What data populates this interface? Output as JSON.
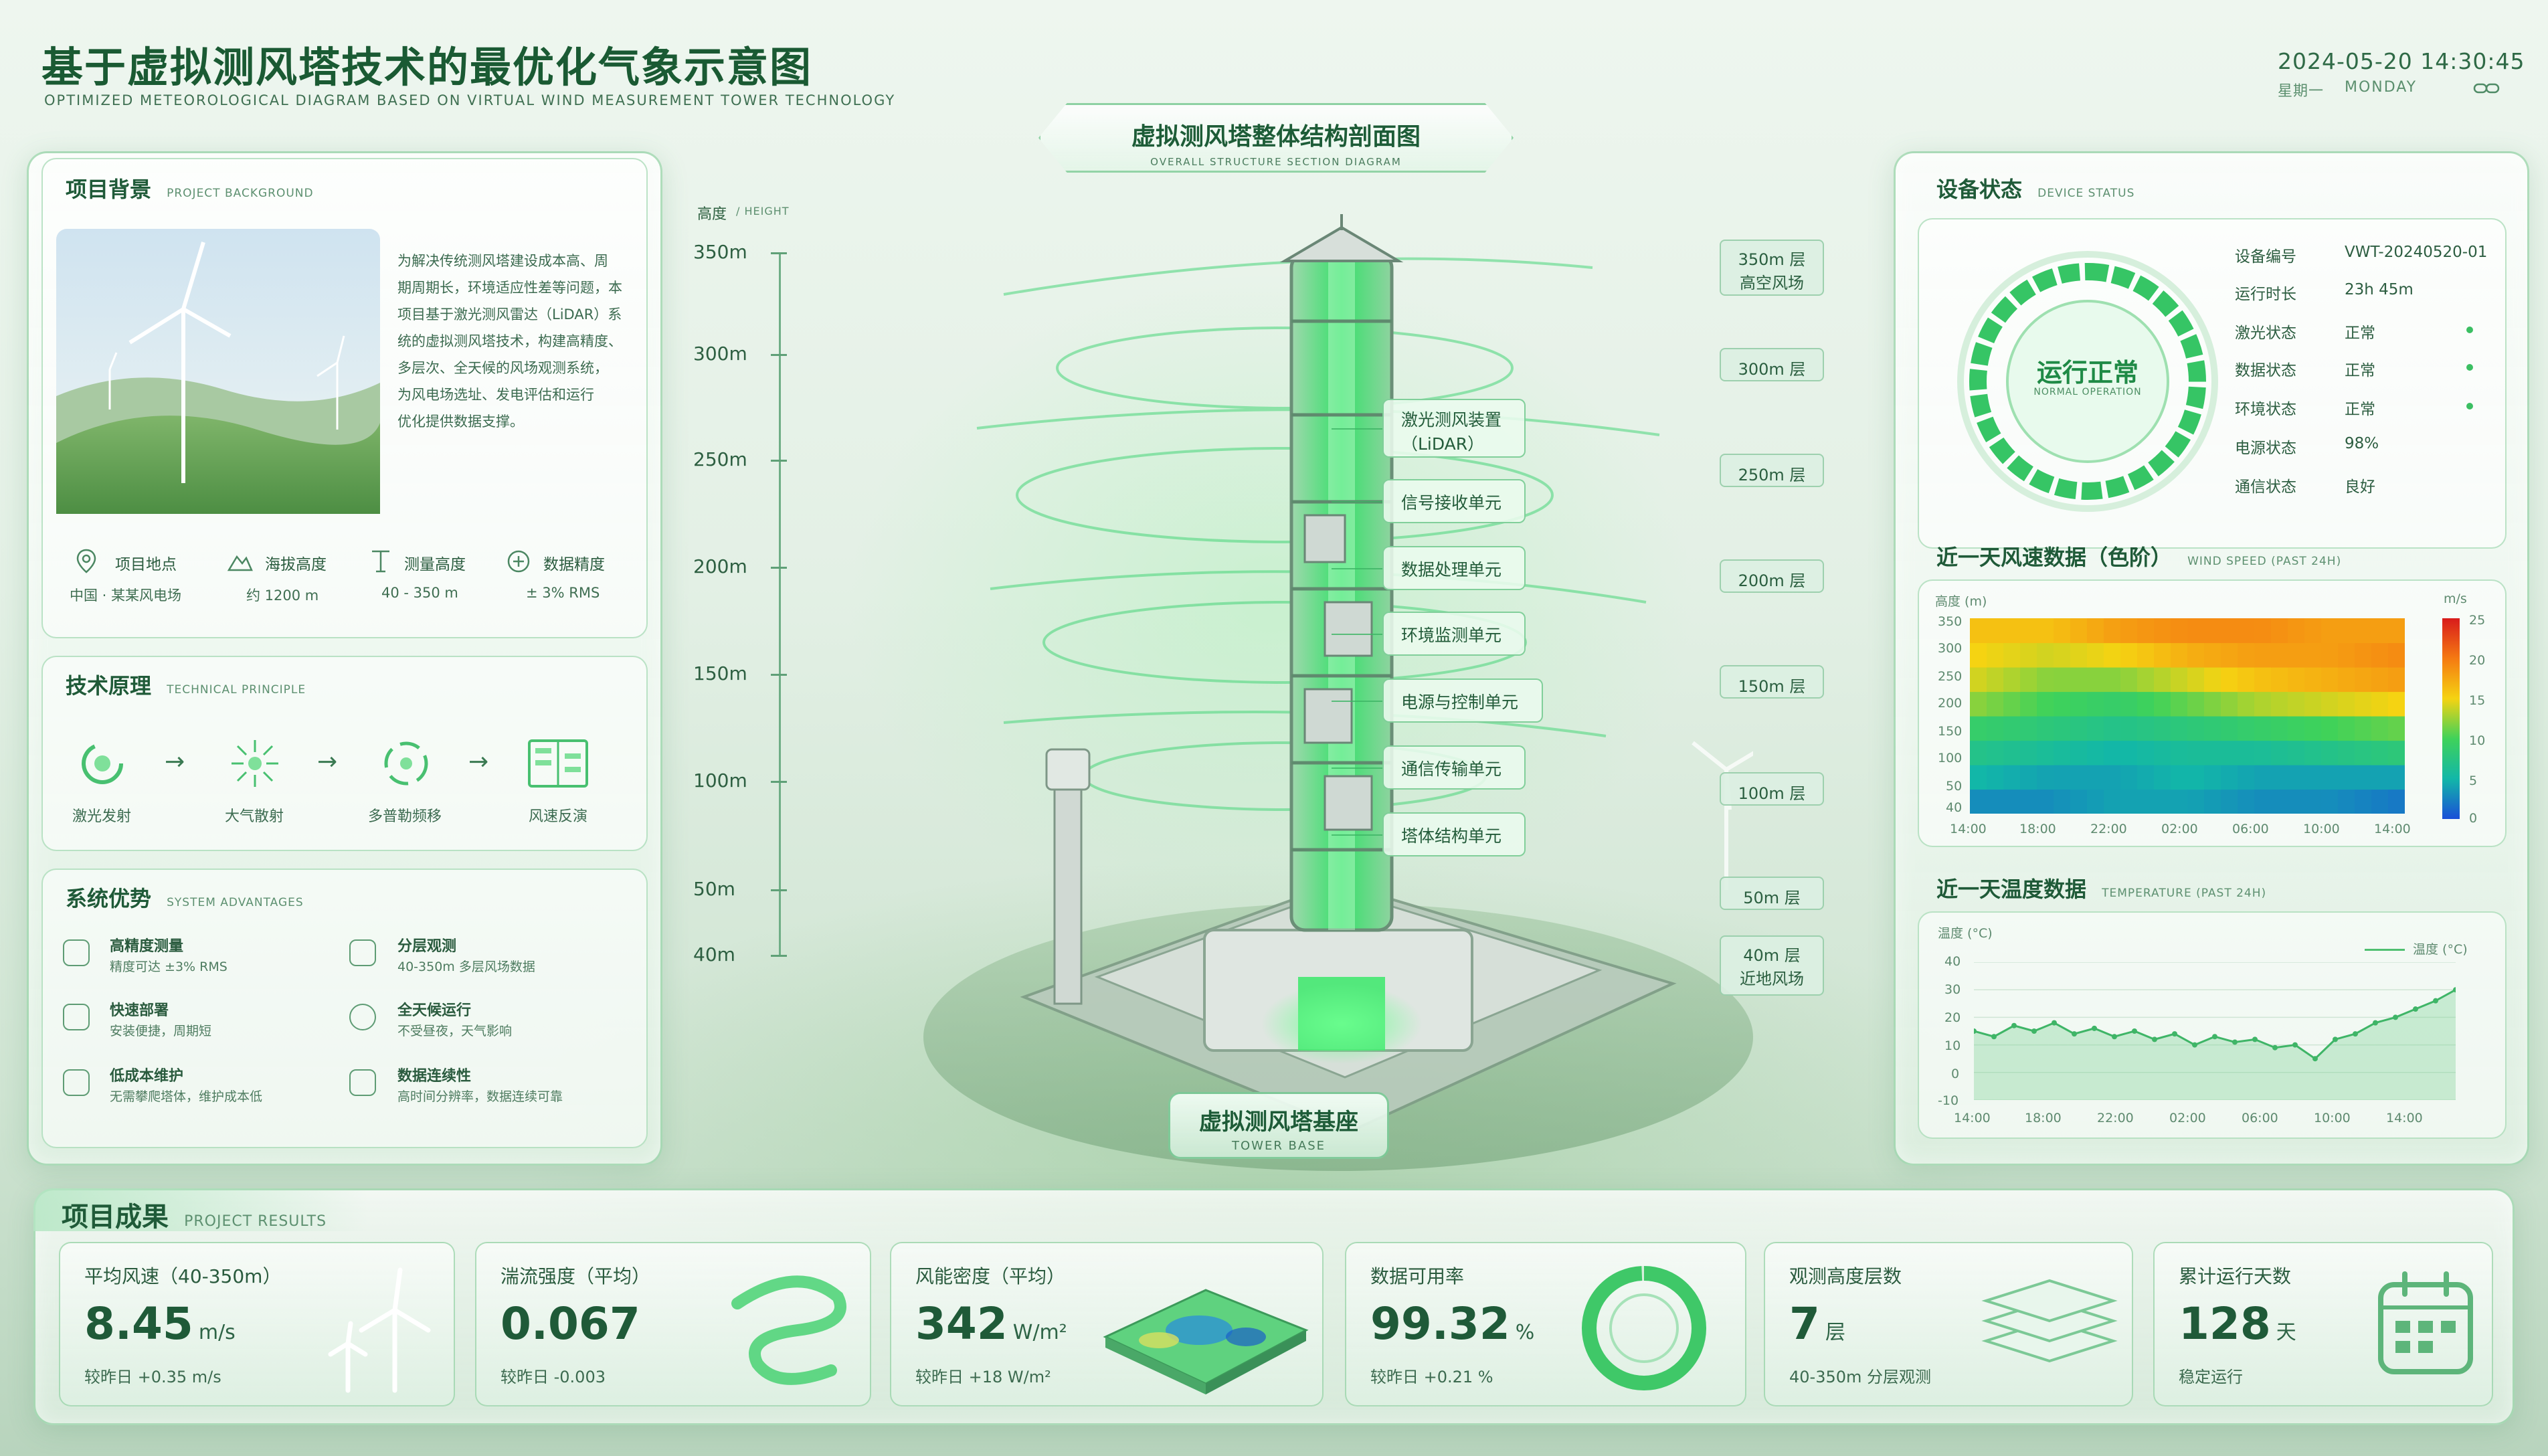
{
  "header": {
    "title": "基于虚拟测风塔技术的最优化气象示意图",
    "subtitle": "OPTIMIZED METEOROLOGICAL DIAGRAM BASED ON VIRTUAL WIND MEASUREMENT TOWER TECHNOLOGY",
    "datetime": "2024-05-20  14:30:45",
    "weekday": "星期一",
    "weekday_en": "MONDAY"
  },
  "center": {
    "title": "虚拟测风塔整体结构剖面图",
    "subtitle": "OVERALL STRUCTURE SECTION DIAGRAM",
    "height_label": "高度",
    "height_label_en": "/ HEIGHT",
    "axis_ticks": [
      "350m",
      "300m",
      "250m",
      "200m",
      "150m",
      "100m",
      "50m",
      "40m"
    ],
    "components": [
      {
        "line1": "激光测风装置",
        "line2": "（LiDAR）"
      },
      {
        "line1": "信号接收单元"
      },
      {
        "line1": "数据处理单元"
      },
      {
        "line1": "环境监测单元"
      },
      {
        "line1": "电源与控制单元"
      },
      {
        "line1": "通信传输单元"
      },
      {
        "line1": "塔体结构单元"
      }
    ],
    "layers": [
      {
        "line1": "350m 层",
        "line2": "高空风场"
      },
      {
        "line1": "300m 层"
      },
      {
        "line1": "250m 层"
      },
      {
        "line1": "200m 层"
      },
      {
        "line1": "150m 层"
      },
      {
        "line1": "100m 层"
      },
      {
        "line1": "50m 层"
      },
      {
        "line1": "40m 层",
        "line2": "近地风场"
      }
    ],
    "base_title": "虚拟测风塔基座",
    "base_subtitle": "TOWER BASE"
  },
  "background": {
    "title": "项目背景",
    "title_en": "PROJECT BACKGROUND",
    "text_lines": [
      "为解决传统测风塔建设成本高、周",
      "期周期长，环境适应性差等问题，本",
      "项目基于激光测风雷达（LiDAR）系",
      "统的虚拟测风塔技术，构建高精度、",
      "多层次、全天候的风场观测系统，",
      "为风电场选址、发电评估和运行",
      "优化提供数据支撑。"
    ],
    "stats": [
      {
        "label": "项目地点",
        "value": "中国 · 某某风电场",
        "icon": "location-pin-icon"
      },
      {
        "label": "海拔高度",
        "value": "约 1200 m",
        "icon": "mountain-icon"
      },
      {
        "label": "测量高度",
        "value": "40 - 350 m",
        "icon": "height-ruler-icon"
      },
      {
        "label": "数据精度",
        "value": "± 3% RMS",
        "icon": "target-icon"
      }
    ]
  },
  "principle": {
    "title": "技术原理",
    "title_en": "TECHNICAL PRINCIPLE",
    "steps": [
      {
        "label": "激光发射",
        "icon": "laser-emit-icon"
      },
      {
        "label": "大气散射",
        "icon": "scatter-icon"
      },
      {
        "label": "多普勒频移",
        "icon": "doppler-icon"
      },
      {
        "label": "风速反演",
        "icon": "inversion-chart-icon"
      }
    ]
  },
  "advantages": {
    "title": "系统优势",
    "title_en": "SYSTEM ADVANTAGES",
    "items": [
      {
        "title": "高精度测量",
        "desc": "精度可达 ±3% RMS",
        "icon": "precision-icon"
      },
      {
        "title": "分层观测",
        "desc": "40-350m 多层风场数据",
        "icon": "layers-icon"
      },
      {
        "title": "快速部署",
        "desc": "安装便捷，周期短",
        "icon": "deploy-icon"
      },
      {
        "title": "全天候运行",
        "desc": "不受昼夜，天气影响",
        "icon": "clock-icon"
      },
      {
        "title": "低成本维护",
        "desc": "无需攀爬塔体，维护成本低",
        "icon": "maintenance-icon"
      },
      {
        "title": "数据连续性",
        "desc": "高时间分辨率，数据连续可靠",
        "icon": "data-continuity-icon"
      }
    ]
  },
  "device": {
    "title": "设备状态",
    "title_en": "DEVICE STATUS",
    "ring_text": "运行正常",
    "ring_text_en": "NORMAL OPERATION",
    "rows": [
      {
        "label": "设备编号",
        "value": "VWT-20240520-01",
        "dot": false
      },
      {
        "label": "运行时长",
        "value": "23h 45m",
        "dot": false
      },
      {
        "label": "激光状态",
        "value": "正常",
        "dot": true
      },
      {
        "label": "数据状态",
        "value": "正常",
        "dot": true
      },
      {
        "label": "环境状态",
        "value": "正常",
        "dot": true
      },
      {
        "label": "电源状态",
        "value": "98%",
        "dot": false
      },
      {
        "label": "通信状态",
        "value": "良好",
        "dot": false
      }
    ]
  },
  "wind_panel": {
    "title": "近一天风速数据（色阶）",
    "title_en": "WIND SPEED (PAST 24H)",
    "ylabel": "高度 (m)",
    "unit": "m/s",
    "y_ticks": [
      "350",
      "300",
      "250",
      "200",
      "150",
      "100",
      "50",
      "40"
    ],
    "x_ticks": [
      "14:00",
      "18:00",
      "22:00",
      "02:00",
      "06:00",
      "10:00",
      "14:00"
    ],
    "scale_ticks": [
      "25",
      "20",
      "15",
      "10",
      "5",
      "0"
    ]
  },
  "temp_panel": {
    "title": "近一天温度数据",
    "title_en": "TEMPERATURE (PAST 24H)",
    "ylabel": "温度 (°C)",
    "legend": "温度 (°C)",
    "y_ticks": [
      "40",
      "30",
      "20",
      "10",
      "0",
      "-10"
    ],
    "x_ticks": [
      "14:00",
      "18:00",
      "22:00",
      "02:00",
      "06:00",
      "10:00",
      "14:00"
    ]
  },
  "results": {
    "title": "项目成果",
    "title_en": "PROJECT RESULTS",
    "cards": [
      {
        "title": "平均风速（40-350m）",
        "value": "8.45",
        "unit": "m/s",
        "note": "较昨日 +0.35 m/s",
        "icon": "wind-turbine-icon"
      },
      {
        "title": "湍流强度（平均）",
        "value": "0.067",
        "unit": "",
        "note": "较昨日 -0.003",
        "icon": "turbulence-swirl-icon"
      },
      {
        "title": "风能密度（平均）",
        "value": "342",
        "unit": "W/m²",
        "note": "较昨日 +18 W/m²",
        "icon": "terrain-map-icon"
      },
      {
        "title": "数据可用率",
        "value": "99.32",
        "unit": "%",
        "note": "较昨日 +0.21 %",
        "icon": "ring-gauge-icon",
        "fraction": 0.9932
      },
      {
        "title": "观测高度层数",
        "value": "7",
        "unit": "层",
        "note": "40-350m 分层观测",
        "icon": "stacked-layers-icon"
      },
      {
        "title": "累计运行天数",
        "value": "128",
        "unit": "天",
        "note": "稳定运行",
        "icon": "calendar-icon"
      }
    ]
  },
  "chart_data": [
    {
      "type": "heatmap",
      "title": "近一天风速数据（色阶）",
      "xlabel": "",
      "ylabel": "高度 (m)",
      "x": [
        "14:00",
        "18:00",
        "22:00",
        "02:00",
        "06:00",
        "10:00",
        "14:00"
      ],
      "y": [
        40,
        50,
        100,
        150,
        200,
        250,
        300,
        350
      ],
      "values_ms": [
        [
          3,
          3,
          4,
          4,
          3,
          3,
          2
        ],
        [
          5,
          4,
          4,
          5,
          4,
          4,
          4
        ],
        [
          7,
          6,
          5,
          6,
          6,
          7,
          8
        ],
        [
          9,
          8,
          7,
          8,
          9,
          10,
          11
        ],
        [
          12,
          10,
          9,
          11,
          13,
          14,
          15
        ],
        [
          14,
          12,
          12,
          14,
          16,
          17,
          18
        ],
        [
          15,
          14,
          15,
          17,
          18,
          18,
          19
        ],
        [
          16,
          16,
          18,
          19,
          19,
          18,
          18
        ]
      ],
      "zlim": [
        0,
        25
      ],
      "unit": "m/s"
    },
    {
      "type": "area",
      "title": "近一天温度数据",
      "xlabel": "",
      "ylabel": "温度 (°C)",
      "x": [
        "14:00",
        "15:00",
        "16:00",
        "17:00",
        "18:00",
        "19:00",
        "20:00",
        "21:00",
        "22:00",
        "23:00",
        "00:00",
        "01:00",
        "02:00",
        "03:00",
        "04:00",
        "05:00",
        "06:00",
        "07:00",
        "08:00",
        "09:00",
        "10:00",
        "11:00",
        "12:00",
        "13:00",
        "14:00"
      ],
      "series": [
        {
          "name": "温度 (°C)",
          "values": [
            15,
            13,
            17,
            15,
            18,
            14,
            16,
            13,
            15,
            12,
            14,
            10,
            13,
            11,
            12,
            9,
            10,
            5,
            12,
            14,
            18,
            20,
            23,
            26,
            30
          ]
        }
      ],
      "ylim": [
        -10,
        40
      ],
      "legend": "top-right"
    }
  ]
}
